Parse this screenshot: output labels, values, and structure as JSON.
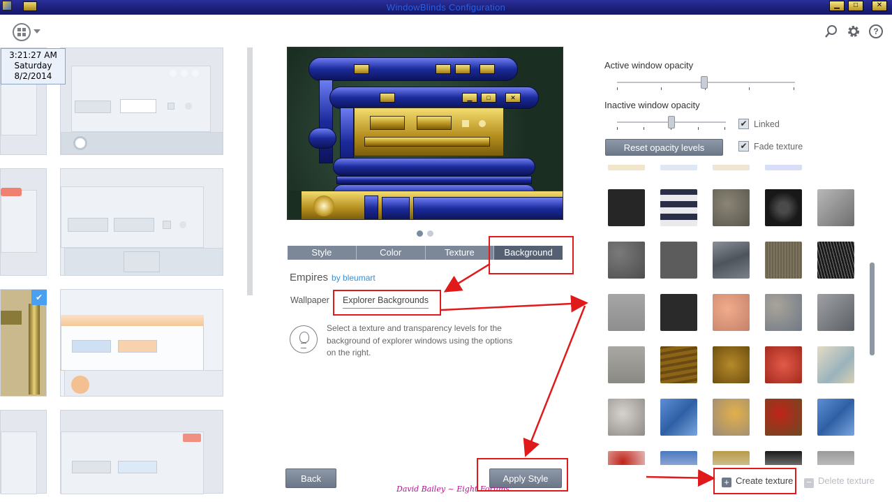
{
  "window": {
    "title": "WindowBlinds Configuration",
    "minimize_glyph": "▁",
    "maximize_glyph": "□",
    "close_glyph": "✕"
  },
  "toolbar": {
    "logo_icon": "windowblinds-logo-icon",
    "search_icon": "search-icon",
    "settings_icon": "gear-icon",
    "help_label": "?"
  },
  "clock": {
    "time": "3:21:27 AM",
    "day": "Saturday",
    "date": "8/2/2014"
  },
  "preview": {
    "pager_count": 2,
    "pager_active": 0
  },
  "tabs": [
    {
      "label": "Style"
    },
    {
      "label": "Color"
    },
    {
      "label": "Texture"
    },
    {
      "label": "Background"
    }
  ],
  "active_tab": "Background",
  "style_info": {
    "name": "Empires",
    "author": "by bleumart"
  },
  "subtabs": {
    "wallpaper": "Wallpaper",
    "explorer": "Explorer Backgrounds"
  },
  "info": {
    "text": "Select a texture and transparency levels for the background of explorer windows using the options on the right."
  },
  "buttons": {
    "back": "Back",
    "apply": "Apply Style"
  },
  "opacity": {
    "active_label": "Active window opacity",
    "active_value_fraction": 0.49,
    "inactive_label": "Inactive window opacity",
    "inactive_value_fraction": 0.5,
    "linked_label": "Linked",
    "linked_checked": true,
    "fade_label": "Fade texture",
    "fade_checked": true,
    "reset_label": "Reset opacity levels",
    "check_glyph": "✔"
  },
  "texture_actions": {
    "create_label": "Create texture",
    "create_glyph": "+",
    "delete_label": "Delete texture",
    "delete_glyph": "−"
  },
  "credit": "David Bailey ~ Eight Forums",
  "colors": {
    "tab_bg": "#7c8797",
    "tab_active_bg": "#556173",
    "annotation_red": "#e01a1a",
    "author_link": "#3a8fd1"
  }
}
